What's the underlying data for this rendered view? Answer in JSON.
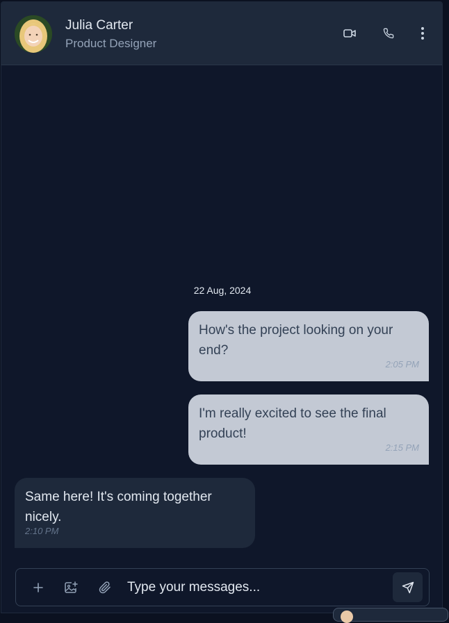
{
  "header": {
    "contact_name": "Julia Carter",
    "contact_role": "Product Designer",
    "icons": [
      "video-icon",
      "phone-icon",
      "more-vertical-icon"
    ]
  },
  "conversation": {
    "date_separator": "22 Aug, 2024",
    "messages": [
      {
        "direction": "outgoing",
        "text": "How's the project looking on your end?",
        "time": "2:05 PM"
      },
      {
        "direction": "outgoing",
        "text": "I'm really excited to see the final product!",
        "time": "2:15 PM"
      },
      {
        "direction": "incoming",
        "text": "Same here! It's coming together nicely.",
        "time": "2:10 PM"
      }
    ]
  },
  "composer": {
    "placeholder": "Type your messages...",
    "value": "",
    "icons": [
      "plus-icon",
      "image-add-icon",
      "paperclip-icon",
      "send-icon"
    ]
  },
  "colors": {
    "background": "#0f172a",
    "header": "#1e293b",
    "outgoing_bubble": "#c3c9d4",
    "incoming_bubble": "#1e293b",
    "text_light": "#e2e8f0",
    "text_muted": "#94a3b8"
  }
}
